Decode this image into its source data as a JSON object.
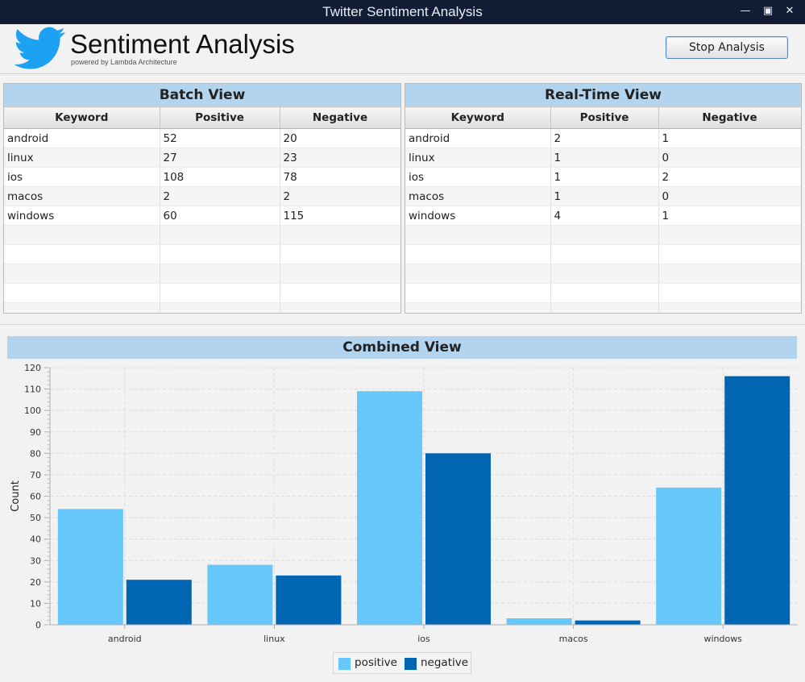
{
  "window": {
    "title": "Twitter Sentiment Analysis",
    "controls": [
      "minimize",
      "maximize",
      "close"
    ]
  },
  "header": {
    "logo_icon": "twitter-bird-icon",
    "title": "Sentiment Analysis",
    "subtitle": "powered by Lambda Architecture",
    "stop_button_label": "Stop Analysis"
  },
  "batch_view": {
    "title": "Batch View",
    "columns": [
      "Keyword",
      "Positive",
      "Negative"
    ],
    "rows": [
      [
        "android",
        "52",
        "20"
      ],
      [
        "linux",
        "27",
        "23"
      ],
      [
        "ios",
        "108",
        "78"
      ],
      [
        "macos",
        "2",
        "2"
      ],
      [
        "windows",
        "60",
        "115"
      ]
    ]
  },
  "realtime_view": {
    "title": "Real-Time View",
    "columns": [
      "Keyword",
      "Positive",
      "Negative"
    ],
    "rows": [
      [
        "android",
        "2",
        "1"
      ],
      [
        "linux",
        "1",
        "0"
      ],
      [
        "ios",
        "1",
        "2"
      ],
      [
        "macos",
        "1",
        "0"
      ],
      [
        "windows",
        "4",
        "1"
      ]
    ]
  },
  "combined_view": {
    "title": "Combined View"
  },
  "colors": {
    "positive": "#66c8fa",
    "negative": "#0066b3",
    "header_band": "#b3d4ef",
    "titlebar": "#121d35"
  },
  "chart_data": {
    "type": "bar",
    "categories": [
      "android",
      "linux",
      "ios",
      "macos",
      "windows"
    ],
    "series": [
      {
        "name": "positive",
        "values": [
          54,
          28,
          109,
          3,
          64
        ]
      },
      {
        "name": "negative",
        "values": [
          21,
          23,
          80,
          2,
          116
        ]
      }
    ],
    "ylabel": "Count",
    "ylim": [
      0,
      120
    ],
    "yticks": [
      0,
      10,
      20,
      30,
      40,
      50,
      60,
      70,
      80,
      90,
      100,
      110,
      120
    ],
    "grid": true,
    "legend": "bottom-center"
  }
}
